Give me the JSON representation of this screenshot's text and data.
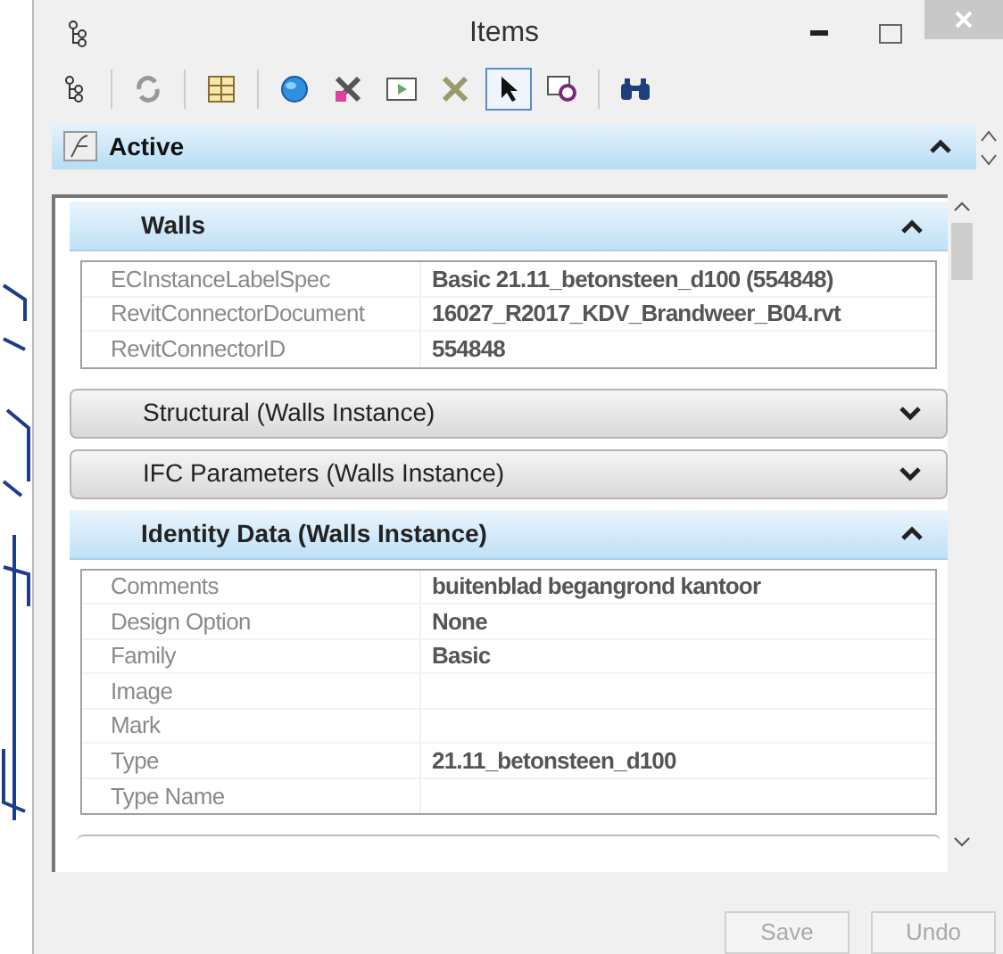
{
  "window": {
    "title": "Items"
  },
  "toolbar": [
    {
      "kind": "tree",
      "selected": false
    },
    {
      "kind": "sep"
    },
    {
      "kind": "refresh",
      "selected": false
    },
    {
      "kind": "sep"
    },
    {
      "kind": "grid",
      "selected": false
    },
    {
      "kind": "sep"
    },
    {
      "kind": "globe",
      "selected": false
    },
    {
      "kind": "cross",
      "selected": false
    },
    {
      "kind": "frame",
      "selected": false
    },
    {
      "kind": "cross2",
      "selected": false
    },
    {
      "kind": "pointer",
      "selected": true
    },
    {
      "kind": "gear",
      "selected": false
    },
    {
      "kind": "sep"
    },
    {
      "kind": "binoculars",
      "selected": false
    }
  ],
  "group": {
    "title": "Active",
    "expanded": true
  },
  "sections": [
    {
      "title": "Walls",
      "expanded": true,
      "properties": [
        {
          "name": "ECInstanceLabelSpec",
          "value": "Basic 21.11_betonsteen_d100 (554848)"
        },
        {
          "name": "RevitConnectorDocument",
          "value": "16027_R2017_KDV_Brandweer_B04.rvt"
        },
        {
          "name": "RevitConnectorID",
          "value": "554848"
        }
      ]
    },
    {
      "title": "Structural (Walls Instance)",
      "expanded": false
    },
    {
      "title": "IFC Parameters (Walls Instance)",
      "expanded": false
    },
    {
      "title": "Identity Data (Walls Instance)",
      "expanded": true,
      "properties": [
        {
          "name": "Comments",
          "value": "buitenblad begangrond kantoor"
        },
        {
          "name": "Design Option",
          "value": "None"
        },
        {
          "name": "Family",
          "value": "Basic"
        },
        {
          "name": "Image"
        },
        {
          "name": "Mark"
        },
        {
          "name": "Type",
          "value": "21.11_betonsteen_d100"
        },
        {
          "name": "Type Name"
        }
      ]
    }
  ],
  "buttons": [
    {
      "label": "Save",
      "disabled": true
    },
    {
      "label": "Undo",
      "disabled": true
    }
  ]
}
